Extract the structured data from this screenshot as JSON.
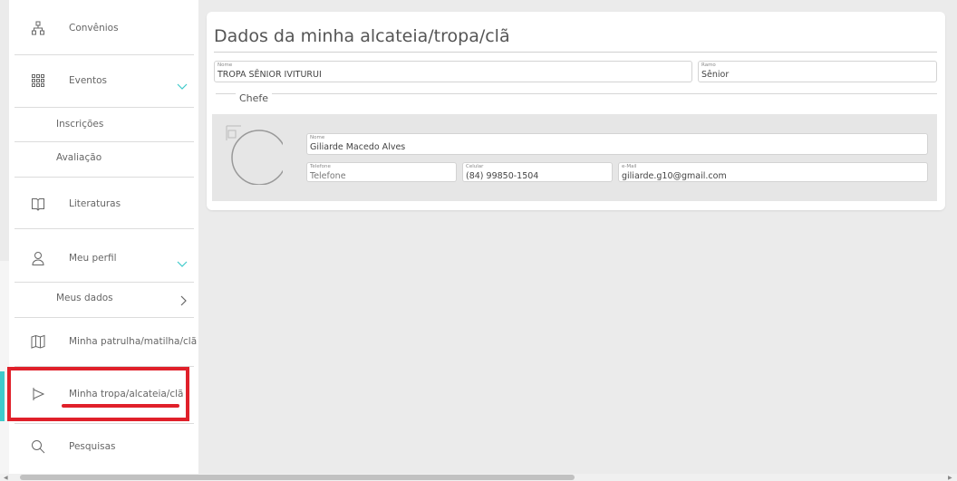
{
  "sidebar": {
    "items": [
      {
        "label": "Convênios",
        "icon": "sitemap-icon"
      },
      {
        "label": "Eventos",
        "icon": "grid-icon"
      },
      {
        "label": "Inscrições"
      },
      {
        "label": "Avaliação"
      },
      {
        "label": "Literaturas",
        "icon": "book-icon"
      },
      {
        "label": "Meu perfil",
        "icon": "user-icon"
      },
      {
        "label": "Meus dados"
      },
      {
        "label": "Minha patrulha/matilha/clã",
        "icon": "map-icon"
      },
      {
        "label": "Minha tropa/alcateia/clã",
        "icon": "flag-icon",
        "active": true
      },
      {
        "label": "Pesquisas",
        "icon": "search-icon"
      }
    ],
    "accent_color": "#3fcacb",
    "highlight_color": "#e0202a"
  },
  "main": {
    "title": "Dados da minha alcateia/tropa/clã",
    "nome": {
      "label": "Nome",
      "value": "TROPA SÊNIOR IVITURUI"
    },
    "ramo": {
      "label": "Ramo",
      "value": "Sênior"
    },
    "chefe": {
      "legend": "Chefe",
      "nome": {
        "label": "Nome",
        "value": "Giliarde Macedo Alves"
      },
      "telefone": {
        "label": "Telefone",
        "placeholder": "Telefone"
      },
      "celular": {
        "label": "Celular",
        "value": "(84) 99850-1504"
      },
      "email": {
        "label": "e-Mail",
        "value": "giliarde.g10@gmail.com"
      }
    }
  }
}
